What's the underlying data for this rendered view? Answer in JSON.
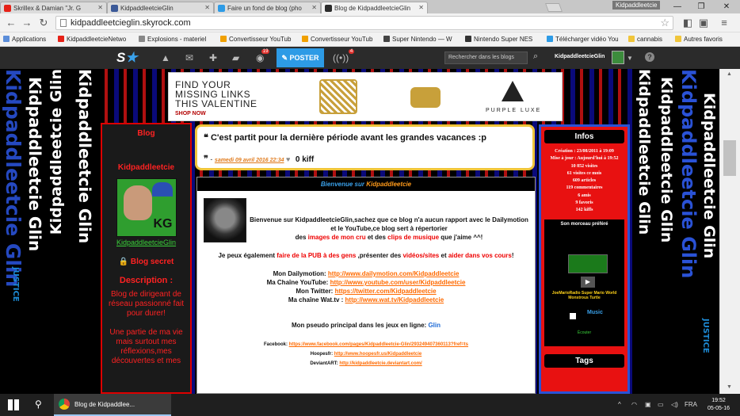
{
  "browser": {
    "tabs": [
      {
        "label": "Skrillex & Damian \"Jr. G",
        "color": "#e62117"
      },
      {
        "label": "KidpaddleetcieGlin",
        "color": "#3b5998"
      },
      {
        "label": "Faire un fond de blog (pho",
        "color": "#2d9be6"
      },
      {
        "label": "Blog de KidpaddleetcieGlin",
        "color": "#2b2b2b"
      }
    ],
    "profile_name": "Kidpaddleetcie",
    "url": "kidpaddleetcieglin.skyrock.com",
    "bookmarks": [
      {
        "label": "Applications",
        "color": "#5b8dd9"
      },
      {
        "label": "KidpaddleetcieNetwo",
        "color": "#e62117"
      },
      {
        "label": "Explosions - materiel",
        "color": "#888888"
      },
      {
        "label": "Convertisseur YouTub",
        "color": "#f0a000"
      },
      {
        "label": "Convertisseur YouTub",
        "color": "#f0a000"
      },
      {
        "label": "Super Nintendo — W",
        "color": "#444444"
      },
      {
        "label": "Nintendo Super NES",
        "color": "#333333"
      },
      {
        "label": "Télécharger vidéo You",
        "color": "#2d9be6"
      },
      {
        "label": "cannabis",
        "color": "#f0c53a"
      },
      {
        "label": "Autres favoris",
        "color": "#f0c53a"
      }
    ]
  },
  "skyrock": {
    "badges": {
      "views": "19",
      "radio": "4"
    },
    "poster_label": "POSTER",
    "search_placeholder": "Rechercher dans les blogs",
    "username": "KidpaddleetcieGlin"
  },
  "side_text": {
    "main": "Kidpaddleetcie Glin",
    "small": "JUSTICE"
  },
  "ad": {
    "headline_1": "FIND YOUR",
    "headline_2": "MISSING LINKS",
    "headline_3": "THIS VALENTINE",
    "cta": "SHOP NOW",
    "brand": "PURPLE LUXE"
  },
  "left_column": {
    "blog_label": "Blog",
    "name": "Kidpaddleetcie",
    "avatar_mark": "KG",
    "username_link": "KidpaddleetcieGlin",
    "secret_label": "Blog secret",
    "description_title": "Description :",
    "description_1": "Blog de dirigeant de réseau passionné fait pour durer!",
    "description_2": "Une partie de ma vie mais surtout mes réflexions,mes découvertes et mes"
  },
  "post": {
    "title": "C'est partit pour la dernière période avant les grandes vacances :p",
    "date": "samedi 09 avril 2016 22:34",
    "kiff": "0 kiff",
    "welcome_1": "Bienvenue sur ",
    "welcome_2": "Kidpaddleetcie",
    "intro_1": "Bienvenue sur KidpaddleetcieGlin,sachez que ce blog n'a aucun rapport avec le Dailymotion et le YouTube,ce blog sert à répertorier",
    "intro_2": "des ",
    "intro_3": "images de mon cru",
    "intro_4": " et des ",
    "intro_5": "clips de musique",
    "intro_6": " que j'aime ^^!",
    "pub_1": "Je peux également ",
    "pub_2": "faire de la PUB à des gens",
    "pub_3": " ,présenter des ",
    "pub_4": "vidéos/sites",
    "pub_5": " et ",
    "pub_6": "aider dans vos cours",
    "pub_7": "!",
    "links": [
      {
        "label": "Mon Dailymotion: ",
        "url": "http://www.dailymotion.com/Kidpaddleetcie"
      },
      {
        "label": "Ma Chaîne YouTube: ",
        "url": "http://www.youtube.com/user/Kidpaddleetcie"
      },
      {
        "label": "Mon Twitter: ",
        "url": "https://twitter.com/Kidpaddleetcie"
      },
      {
        "label": "Ma chaîne Wat.tv : ",
        "url": "http://www.wat.tv/Kidpaddleetcie"
      }
    ],
    "pseudo_label": "Mon pseudo principal dans les jeux en ligne: ",
    "pseudo_value": "Glin",
    "small_links": [
      {
        "label": "Facebook: ",
        "url": "https://www.facebook.com/pages/Kidpaddleetcie-Glin/293249407360113?fref=ts"
      },
      {
        "label": "Hoopesfr: ",
        "url": "http://www.hoopesfr.us/Kidpaddleetcie"
      },
      {
        "label": "DeviantART: ",
        "url": "http://kidpaddleetcie.deviantart.com/"
      }
    ]
  },
  "right_column": {
    "infos_title": "Infos",
    "infos": [
      "Création : 23/08/2011 à 19:09",
      "Mise à jour : Aujourd'hui à 19:52",
      "10 852 visites",
      "61 visites ce mois",
      "609 articles",
      "119 commentaires",
      "6 amis",
      "9 favoris",
      "142 kiffs"
    ],
    "morceau_title": "Son morceau préféré",
    "track": "JoeMarioRadio Super Mario World Monstrous Turtle",
    "music_label": "Music",
    "ecouter": "Écouter",
    "tags_title": "Tags"
  },
  "taskbar": {
    "task_label": "Blog de Kidpaddlee...",
    "lang": "FRA",
    "time": "19:52",
    "date": "05-05-16"
  }
}
